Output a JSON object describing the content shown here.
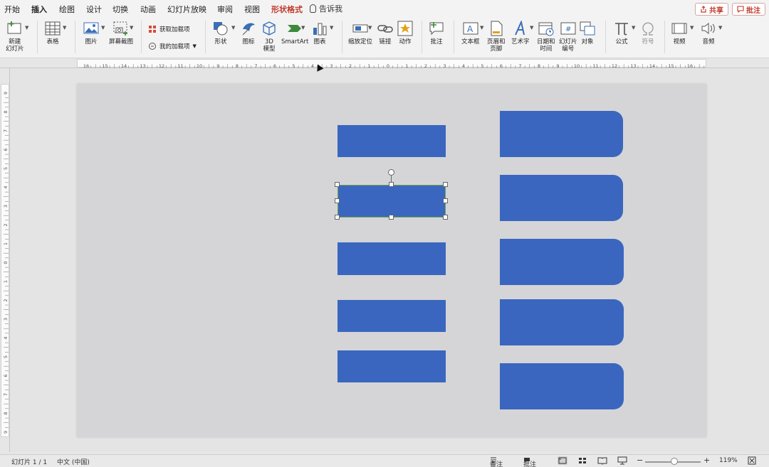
{
  "tabs": [
    {
      "label": "开始"
    },
    {
      "label": "插入",
      "active": true
    },
    {
      "label": "绘图"
    },
    {
      "label": "设计"
    },
    {
      "label": "切换"
    },
    {
      "label": "动画"
    },
    {
      "label": "幻灯片放映"
    },
    {
      "label": "审阅"
    },
    {
      "label": "视图"
    },
    {
      "label": "形状格式",
      "accent": true
    }
  ],
  "tell_me": "告诉我",
  "share_label": "共享",
  "comments_label": "批注",
  "ribbon": {
    "new_slide": "新建\n幻灯片",
    "table": "表格",
    "picture": "图片",
    "screenshot": "屏幕截图",
    "get_addins": "获取加载项",
    "my_addins": "我的加载项",
    "shapes": "形状",
    "icons": "图标",
    "model3d": "3D\n模型",
    "smartart": "SmartArt",
    "chart": "图表",
    "zoom": "缩放定位",
    "link": "链接",
    "action": "动作",
    "comment": "批注",
    "textbox": "文本框",
    "header_footer": "页眉和\n页脚",
    "wordart": "艺术字",
    "datetime": "日期和\n时间",
    "slide_number": "幻灯片\n编号",
    "object": "对象",
    "equation": "公式",
    "symbol": "符号",
    "video": "视频",
    "audio": "音频"
  },
  "ruler_numbers": [
    "16",
    "15",
    "14",
    "13",
    "12",
    "11",
    "10",
    "9",
    "8",
    "7",
    "6",
    "5",
    "4",
    "3",
    "2",
    "1",
    "0",
    "1",
    "2",
    "3",
    "4",
    "5",
    "6",
    "7",
    "8",
    "9",
    "10",
    "11",
    "12",
    "13",
    "14",
    "15",
    "16"
  ],
  "vruler_numbers": [
    "9",
    "8",
    "7",
    "6",
    "5",
    "4",
    "3",
    "2",
    "1",
    "0",
    "1",
    "2",
    "3",
    "4",
    "5",
    "6",
    "7",
    "8",
    "9"
  ],
  "colors": {
    "shape_fill": "#3a66bf",
    "accent": "#c0392b",
    "selection": "#6aa84f"
  },
  "status": {
    "slide_info": "幻灯片 1 / 1",
    "language": "中文 (中国)",
    "notes": "备注",
    "comments": "批注",
    "zoom_percent": "119%"
  }
}
